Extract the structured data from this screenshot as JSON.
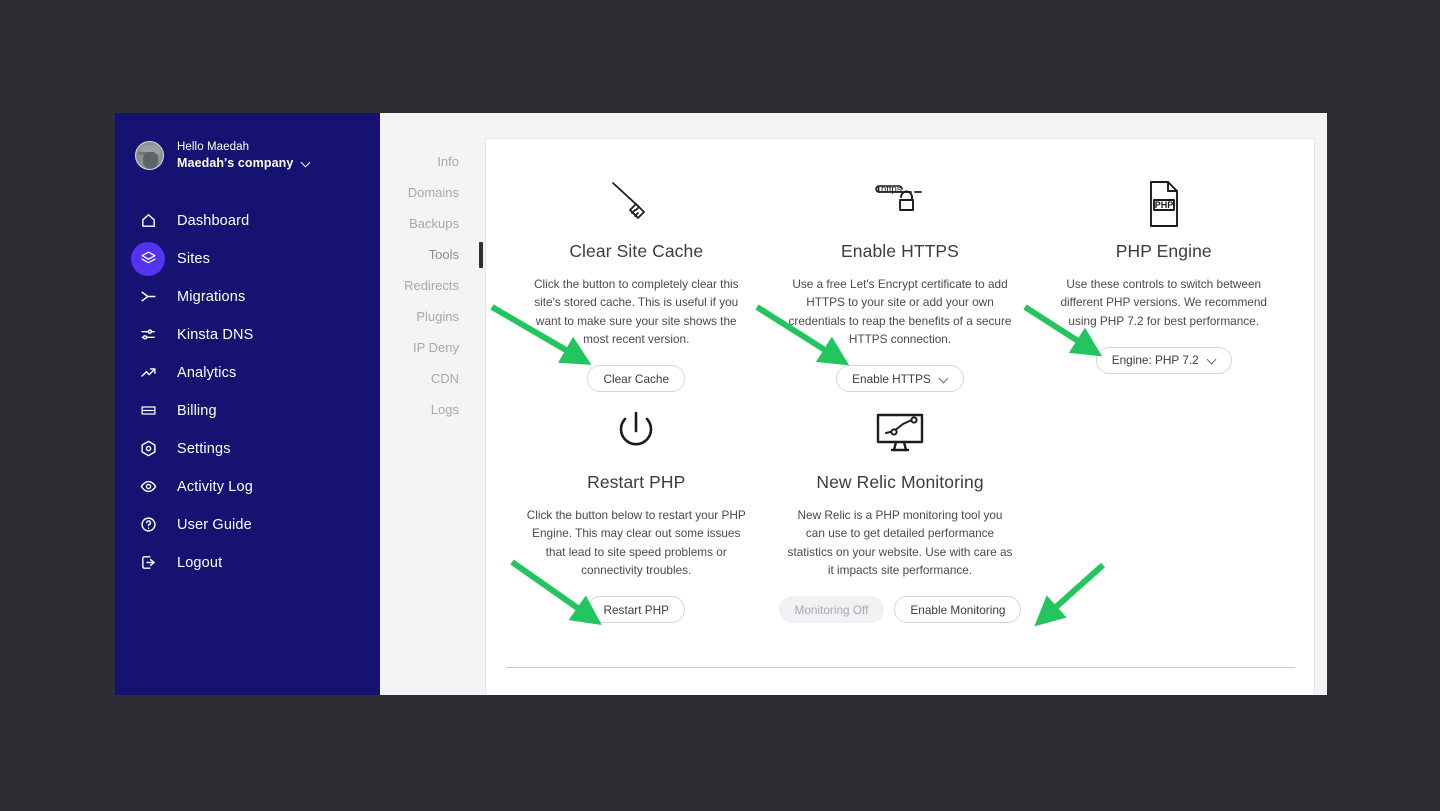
{
  "sidebar": {
    "user": {
      "greeting": "Hello Maedah",
      "company": "Maedah's company",
      "avatar_icon": "user-avatar",
      "chevron_icon": "chevron-down-icon"
    },
    "items": [
      {
        "label": "Dashboard",
        "icon": "home-icon",
        "active": false
      },
      {
        "label": "Sites",
        "icon": "layers-icon",
        "active": true
      },
      {
        "label": "Migrations",
        "icon": "merge-arrow-icon",
        "active": false
      },
      {
        "label": "Kinsta DNS",
        "icon": "shuffle-icon",
        "active": false
      },
      {
        "label": "Analytics",
        "icon": "trending-up-icon",
        "active": false
      },
      {
        "label": "Billing",
        "icon": "credit-card-icon",
        "active": false
      },
      {
        "label": "Settings",
        "icon": "gear-hex-icon",
        "active": false
      },
      {
        "label": "Activity Log",
        "icon": "eye-icon",
        "active": false
      },
      {
        "label": "User Guide",
        "icon": "question-circle-icon",
        "active": false
      },
      {
        "label": "Logout",
        "icon": "logout-icon",
        "active": false
      }
    ],
    "accent_color": "#5333ed",
    "background_color": "#151272"
  },
  "subnav": {
    "items": [
      {
        "label": "Info",
        "active": false
      },
      {
        "label": "Domains",
        "active": false
      },
      {
        "label": "Backups",
        "active": false
      },
      {
        "label": "Tools",
        "active": true
      },
      {
        "label": "Redirects",
        "active": false
      },
      {
        "label": "Plugins",
        "active": false
      },
      {
        "label": "IP Deny",
        "active": false
      },
      {
        "label": "CDN",
        "active": false
      },
      {
        "label": "Logs",
        "active": false
      }
    ]
  },
  "tools": [
    {
      "title": "Clear Site Cache",
      "icon": "broom-icon",
      "description": "Click the button to completely clear this site's stored cache. This is useful if you want to make sure your site shows the most recent version.",
      "buttons": [
        {
          "label": "Clear Cache",
          "style": "outline",
          "caret": false
        }
      ]
    },
    {
      "title": "Enable HTTPS",
      "icon": "https-lock-icon",
      "icon_text": "https",
      "description": "Use a free Let's Encrypt certificate to add HTTPS to your site or add your own credentials to reap the benefits of a secure HTTPS connection.",
      "buttons": [
        {
          "label": "Enable HTTPS",
          "style": "outline",
          "caret": true
        }
      ]
    },
    {
      "title": "PHP Engine",
      "icon": "php-file-icon",
      "icon_text": "PHP",
      "description": "Use these controls to switch between different PHP versions. We recommend using PHP 7.2 for best performance.",
      "buttons": [
        {
          "label": "Engine: PHP 7.2",
          "style": "outline",
          "caret": true
        }
      ]
    },
    {
      "title": "Restart PHP",
      "icon": "power-icon",
      "description": "Click the button below to restart your PHP Engine. This may clear out some issues that lead to site speed problems or connectivity troubles.",
      "buttons": [
        {
          "label": "Restart PHP",
          "style": "outline",
          "caret": false
        }
      ]
    },
    {
      "title": "New Relic Monitoring",
      "icon": "monitor-chart-icon",
      "description": "New Relic is a PHP monitoring tool you can use to get detailed performance statistics on your website. Use with care as it impacts site performance.",
      "buttons": [
        {
          "label": "Monitoring Off",
          "style": "disabled",
          "caret": false
        },
        {
          "label": "Enable Monitoring",
          "style": "outline",
          "caret": false
        }
      ]
    }
  ],
  "annotations": {
    "arrow_color": "#22c55e",
    "arrow_count": 5
  }
}
